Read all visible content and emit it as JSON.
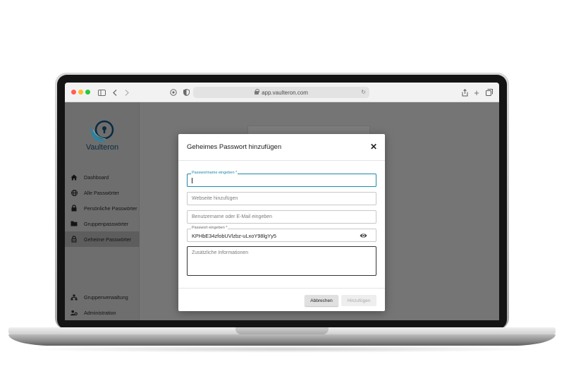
{
  "browser": {
    "url": "app.vaulteron.com"
  },
  "app": {
    "brand": "Vaulteron",
    "colors": {
      "accent": "#1e88a8",
      "brand_dark": "#0c2a3f",
      "overlay": "#757575"
    }
  },
  "sidebar": {
    "items": [
      {
        "label": "Dashboard",
        "icon": "home-icon"
      },
      {
        "label": "Alle Passwörter",
        "icon": "globe-icon"
      },
      {
        "label": "Persönliche Passwörter",
        "icon": "lock-icon"
      },
      {
        "label": "Gruppenpasswörter",
        "icon": "folder-icon"
      },
      {
        "label": "Geheime Passwörter",
        "icon": "vault-icon",
        "active": true
      }
    ],
    "bottom_items": [
      {
        "label": "Gruppenverwaltung",
        "icon": "sitemap-icon"
      },
      {
        "label": "Administration",
        "icon": "users-cog-icon"
      }
    ]
  },
  "modal": {
    "title": "Geheimes Passwort hinzufügen",
    "fields": {
      "name": {
        "label": "Passwortname eingeben *",
        "value": ""
      },
      "website": {
        "placeholder": "Webseite hinzufügen"
      },
      "username": {
        "placeholder": "Benutzername oder E-Mail eingeben"
      },
      "password": {
        "label": "Passwort eingeben *",
        "value": "KPHbE34zfobUVlzbz-uLxoY98lgYy5"
      },
      "notes": {
        "placeholder": "Zusätzliche Informationen"
      }
    },
    "buttons": {
      "cancel": "Abbrechen",
      "add": "Hinzufügen"
    }
  }
}
